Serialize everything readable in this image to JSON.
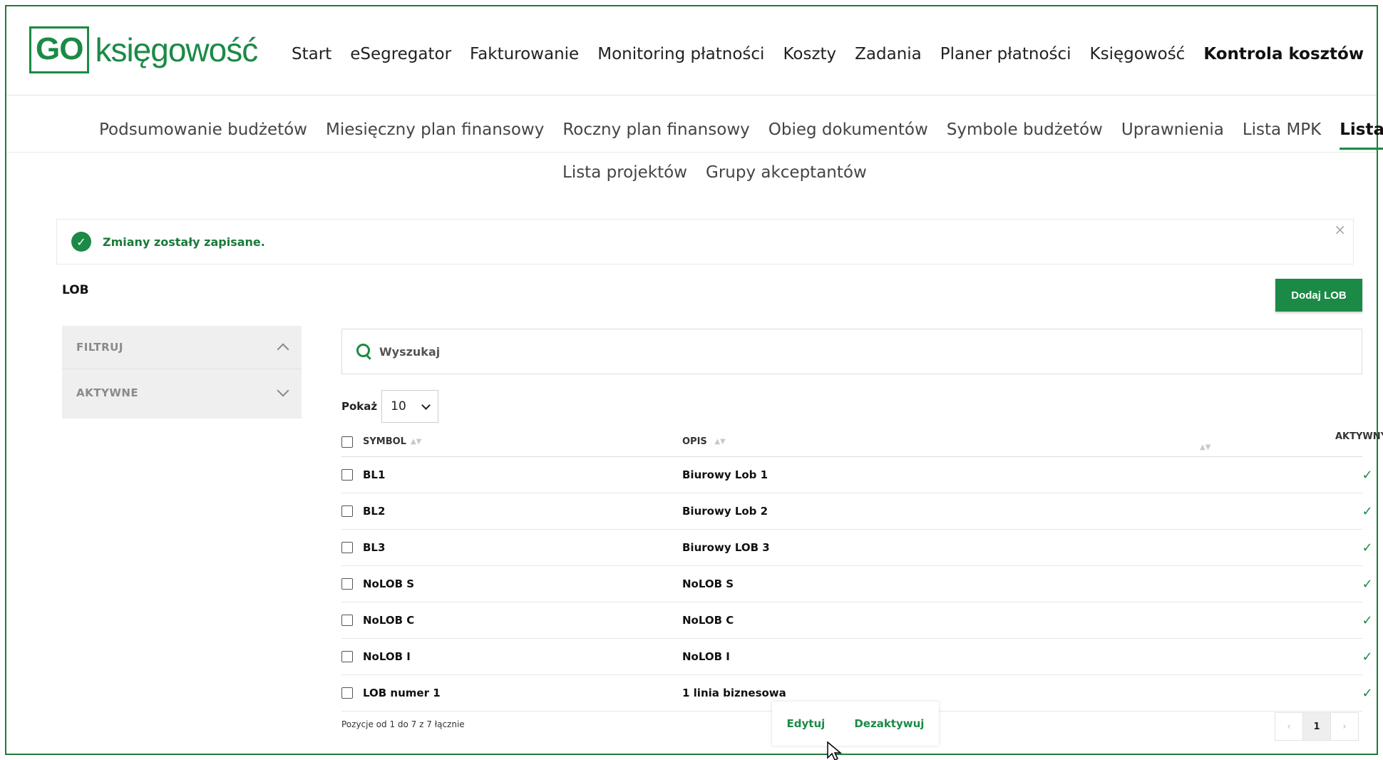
{
  "logo": {
    "box_text": "GO",
    "text": "księgowość"
  },
  "main_nav": [
    "Start",
    "eSegregator",
    "Fakturowanie",
    "Monitoring płatności",
    "Koszty",
    "Zadania",
    "Planer płatności",
    "Księgowość",
    "Kontrola kosztów"
  ],
  "main_nav_active": "Kontrola kosztów",
  "sub_nav": [
    "Podsumowanie budżetów",
    "Miesięczny plan finansowy",
    "Roczny plan finansowy",
    "Obieg dokumentów",
    "Symbole budżetów",
    "Uprawnienia",
    "Lista MPK",
    "Lista LOB"
  ],
  "sub_nav_active": "Lista LOB",
  "sub_nav2": [
    "Lista projektów",
    "Grupy akceptantów"
  ],
  "alert": {
    "text": "Zmiany zostały zapisane.",
    "close": "×",
    "icon": "check-circle-icon"
  },
  "page": {
    "title": "LOB",
    "add_button": "Dodaj LOB"
  },
  "filter": {
    "title": "FILTRUJ",
    "active_label": "AKTYWNE"
  },
  "search": {
    "placeholder": "Wyszukaj"
  },
  "show": {
    "label": "Pokaż",
    "value": "10"
  },
  "table": {
    "headers": {
      "symbol": "SYMBOL",
      "opis": "OPIS",
      "aktywny": "AKTYWNY"
    },
    "rows": [
      {
        "symbol": "BL1",
        "opis": "Biurowy Lob 1",
        "active": "✓"
      },
      {
        "symbol": "BL2",
        "opis": "Biurowy Lob 2",
        "active": "✓"
      },
      {
        "symbol": "BL3",
        "opis": "Biurowy LOB 3",
        "active": "✓"
      },
      {
        "symbol": "NoLOB S",
        "opis": "NoLOB S",
        "active": "✓"
      },
      {
        "symbol": "NoLOB C",
        "opis": "NoLOB C",
        "active": "✓"
      },
      {
        "symbol": "NoLOB I",
        "opis": "NoLOB I",
        "active": "✓"
      },
      {
        "symbol": "LOB numer 1",
        "opis": "1 linia biznesowa",
        "active": "✓"
      }
    ]
  },
  "footer": {
    "info": "Pozycje od 1 do 7 z 7 łącznie"
  },
  "context_menu": {
    "edit": "Edytuj",
    "deactivate": "Dezaktywuj"
  },
  "pager": {
    "prev": "‹",
    "current": "1",
    "next": "›"
  },
  "colors": {
    "brand": "#1b8a46"
  }
}
